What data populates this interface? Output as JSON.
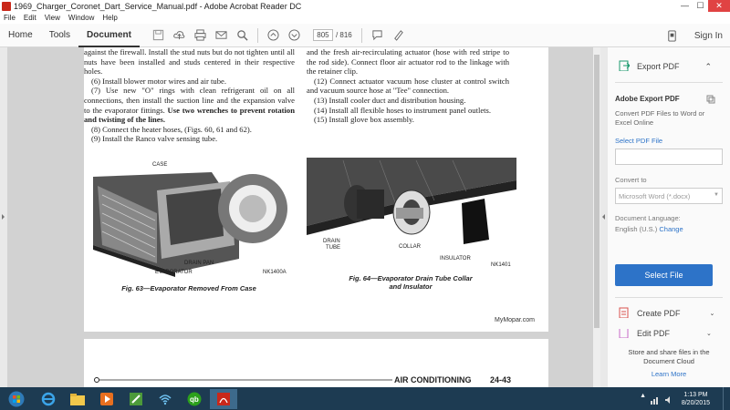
{
  "window": {
    "title": "1969_Charger_Coronet_Dart_Service_Manual.pdf - Adobe Acrobat Reader DC",
    "minimize": "—",
    "maximize": "☐",
    "close": "✕"
  },
  "menu": [
    "File",
    "Edit",
    "View",
    "Window",
    "Help"
  ],
  "toolbar": {
    "tabs": [
      "Home",
      "Tools",
      "Document"
    ],
    "active_tab": "Document",
    "page_current": "805",
    "page_total": "/ 816",
    "sign_in": "Sign In"
  },
  "page": {
    "left_col": [
      "against the firewall. Install the stud nuts but do not tighten until all nuts have been installed and studs centered in their respective holes.",
      "(6) Install blower motor wires and air tube.",
      "(7) Use new \"O\" rings with clean refrigerant oil on all connections, then install the suction line and the expansion valve to the evaporator fittings.",
      "Use two wrenches to prevent rotation and twisting of the lines.",
      "(8) Connect the heater hoses, (Figs. 60, 61 and 62).",
      "(9) Install the Ranco valve sensing tube."
    ],
    "right_col": [
      "and the fresh air-recirculating actuator (hose with red stripe to the rod side). Connect floor air actuator rod to the linkage with the retainer clip.",
      "(12) Connect actuator vacuum hose cluster at control switch and vacuum source hose at \"Tee\" connection.",
      "(13) Install cooler duct and distribution housing.",
      "(14) Install all flexible hoses to instrument panel outlets.",
      "(15) Install glove box assembly."
    ],
    "fig63": {
      "caption": "Fig. 63—Evaporator Removed From Case",
      "labels": {
        "case": "CASE",
        "drain_pan": "DRAIN PAN",
        "evaporator": "EVAPORATOR",
        "code": "NK1400A"
      }
    },
    "fig64": {
      "caption_line1": "Fig. 64—Evaporator Drain Tube Collar",
      "caption_line2": "and Insulator",
      "labels": {
        "drain": "DRAIN",
        "tube": "TUBE",
        "collar": "COLLAR",
        "insulator": "INSULATOR",
        "code": "NK1401"
      }
    },
    "watermark": "MyMopar.com",
    "footer": {
      "section": "AIR CONDITIONING",
      "page_no": "24-43"
    }
  },
  "panel": {
    "export_pdf": "Export PDF",
    "adobe_export": "Adobe Export PDF",
    "convert_desc": "Convert PDF Files to Word or Excel Online",
    "select_pdf": "Select PDF File",
    "convert_to": "Convert to",
    "format": "Microsoft Word (*.docx)",
    "doc_lang": "Document Language:",
    "lang_value": "English (U.S.)",
    "change": "Change",
    "select_file": "Select File",
    "create_pdf": "Create PDF",
    "edit_pdf": "Edit PDF",
    "cloud_text": "Store and share files in the Document Cloud",
    "learn_more": "Learn More"
  },
  "clock": {
    "time": "1:13 PM",
    "date": "8/20/2015"
  },
  "colors": {
    "accent": "#2d73c8",
    "taskbar": "#1d3b52",
    "close": "#e04343"
  }
}
